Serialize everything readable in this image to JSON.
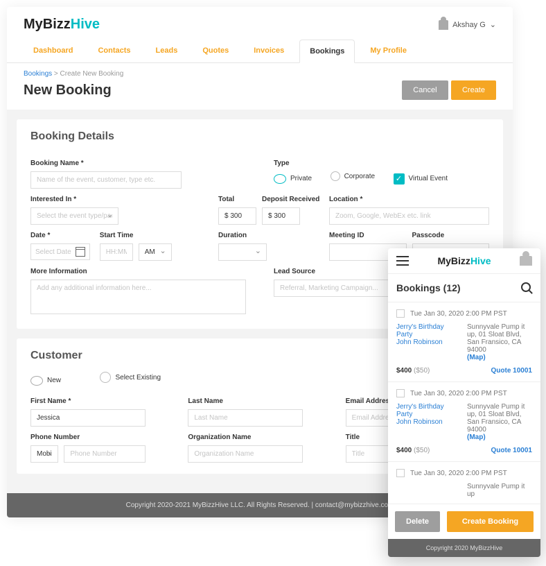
{
  "logo": {
    "a": "MyBizz",
    "b": "Hive"
  },
  "user": {
    "name": "Akshay G",
    "caret": "⌄"
  },
  "nav": {
    "items": [
      "Dashboard",
      "Contacts",
      "Leads",
      "Quotes",
      "Invoices",
      "Bookings",
      "My Profile"
    ],
    "active": 5
  },
  "crumbs": {
    "root": "Bookings",
    "sep": ">",
    "current": "Create New Booking"
  },
  "page": {
    "title": "New Booking"
  },
  "buttons": {
    "cancel": "Cancel",
    "create": "Create"
  },
  "details": {
    "heading": "Booking Details",
    "name_label": "Booking Name *",
    "name_ph": "Name of the event, customer, type etc.",
    "type_label": "Type",
    "type_options": {
      "private": "Private",
      "corporate": "Corporate",
      "virtual": "Virtual Event"
    },
    "interested_label": "Interested In *",
    "interested_ph": "Select the event type/package",
    "total_label": "Total",
    "total_value": "$ 300",
    "deposit_label": "Deposit Received",
    "deposit_value": "$ 300",
    "location_label": "Location *",
    "location_ph": "Zoom, Google, WebEx etc. link",
    "date_label": "Date *",
    "date_ph": "Select Date",
    "start_label": "Start Time",
    "start_ph": "HH:MM",
    "ampm": "AM",
    "duration_label": "Duration",
    "meeting_label": "Meeting ID",
    "passcode_label": "Passcode",
    "more_label": "More Information",
    "more_ph": "Add any additional information here...",
    "lead_label": "Lead Source",
    "lead_ph": "Referral, Marketing Campaign..."
  },
  "customer": {
    "heading": "Customer",
    "new": "New",
    "existing": "Select Existing",
    "first_label": "First Name *",
    "first_value": "Jessica",
    "last_label": "Last Name",
    "last_ph": "Last Name",
    "email_label": "Email Address",
    "email_ph": "Email Address",
    "phone_label": "Phone Number",
    "phone_type": "Mobile",
    "phone_ph": "Phone Number",
    "org_label": "Organization Name",
    "org_ph": "Organization Name",
    "title_label": "Title",
    "title_ph": "Title"
  },
  "footer": "Copyright 2020-2021 MyBizzHive LLC. All Rights Reserved.    |    contact@mybizzhive.com",
  "mobile": {
    "title": "Bookings (12)",
    "items": [
      {
        "date": "Tue Jan 30, 2020 2:00 PM PST",
        "event": "Jerry's Birthday Party",
        "contact": "John Robinson",
        "addr": "Sunnyvale Pump it up, 01 Sloat Blvd, San Fransico, CA 94000",
        "map": "(Map)",
        "price": "$400",
        "deposit": "($50)",
        "quote": "Quote 10001"
      },
      {
        "date": "Tue Jan 30, 2020 2:00 PM PST",
        "event": "Jerry's Birthday Party",
        "contact": "John Robinson",
        "addr": "Sunnyvale Pump it up, 01 Sloat Blvd, San Fransico, CA 94000",
        "map": "(Map)",
        "price": "$400",
        "deposit": "($50)",
        "quote": "Quote 10001"
      },
      {
        "date": "Tue Jan 30, 2020 2:00 PM PST",
        "event": "",
        "contact": "",
        "addr": "Sunnyvale Pump it up",
        "map": "",
        "price": "",
        "deposit": "",
        "quote": ""
      }
    ],
    "delete": "Delete",
    "create": "Create Booking",
    "footer": "Copyright 2020 MyBizzHive"
  }
}
